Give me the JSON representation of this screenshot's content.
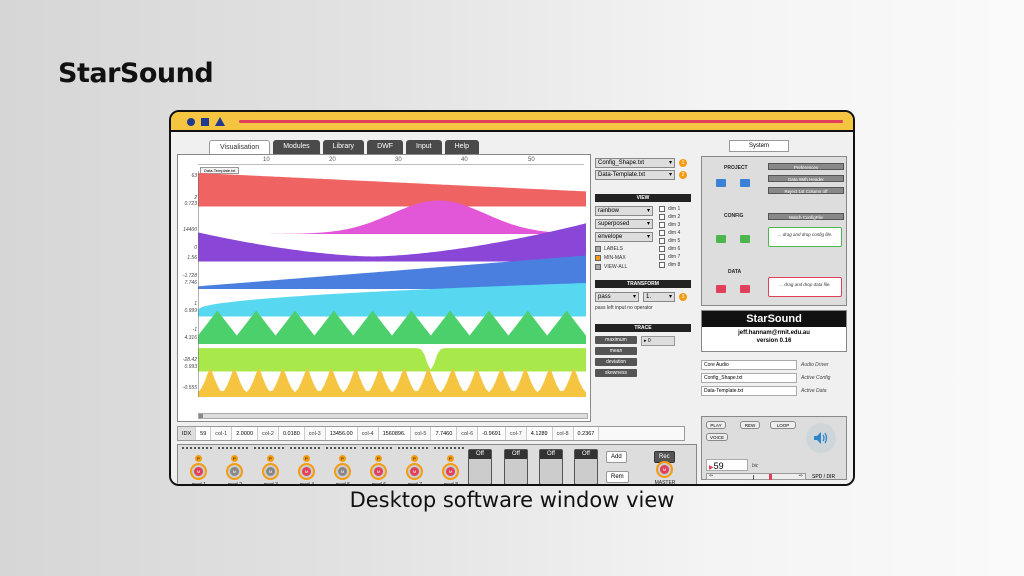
{
  "brand": "StarSound",
  "caption": "Desktop software window view",
  "tabs": [
    "Visualisation",
    "Modules",
    "Library",
    "DWF",
    "Input",
    "Help"
  ],
  "ruler": [
    "10",
    "20",
    "30",
    "40",
    "50"
  ],
  "label_chip": "Data-Template.txt",
  "ylabels": [
    "63",
    "2",
    "0.723",
    "14400",
    "0",
    "1.56",
    "-1.728",
    "7.746",
    "1",
    "0.999",
    "-1",
    "4.316",
    "-28.42",
    "0.993",
    "-0.555"
  ],
  "idx": {
    "cells": [
      "IDX",
      "59",
      "col-1",
      "2.0000",
      "col-2",
      "0.0180",
      "col-3",
      "13456.00",
      "col-4",
      "1560896.",
      "col-5",
      "7.7460",
      "col-6",
      "-0.9691",
      "col-7",
      "4.1289",
      "col-8",
      "0.2367"
    ]
  },
  "mods": [
    "mod-1",
    "mod-2",
    "mod-3",
    "mod-4",
    "mod-5",
    "mod-6",
    "mod-7",
    "mod-8"
  ],
  "mixer": {
    "off": "Off",
    "p": "P",
    "m": "M",
    "add": "Add",
    "rem": "Rem",
    "rec": "Rec",
    "master": "MASTER"
  },
  "controls": {
    "config_file": "Config_Shape.txt",
    "data_file": "Data-Template.txt",
    "badge1": "1",
    "badge2": "2",
    "badge3": "3",
    "view_header": "VIEW",
    "color_mode": "rainbow",
    "layout_mode": "superposed",
    "shape_mode": "envelope",
    "checks": [
      "LABELS",
      "MIN-MAX",
      "VIEW-ALL"
    ],
    "dims": [
      "dim 1",
      "dim 2",
      "dim 3",
      "dim 4",
      "dim 5",
      "dim 6",
      "dim 7",
      "dim 8"
    ],
    "transform_header": "TRANSFORM",
    "transform_mode": "pass",
    "transform_value": "1.",
    "transform_note": "pass left input no operator",
    "trace_header": "TRACE",
    "trace_buttons": [
      "maximum",
      "mean",
      "deviation",
      "skewness"
    ],
    "trace_value": "0"
  },
  "system": {
    "tab": "System",
    "project": "PROJECT",
    "preferences": "Preferences",
    "data_with_header": "Data With Header",
    "reject_col": "Reject 1st Column off",
    "config": "CONFIG",
    "watch_config": "Watch ConfigFile",
    "config_drop": "... drag and drop config file.",
    "data": "DATA",
    "data_drop": "... drag and drop data file.",
    "app_name": "StarSound",
    "email": "jeff.hannam@rmit.edu.au",
    "version": "version 0.16",
    "audio_driver_val": "Core Audio",
    "audio_driver_key": "Audio Driver",
    "active_config_val": "Config_Shape.txt",
    "active_config_key": "Active Config",
    "active_data_val": "Data-Template.txt",
    "active_data_key": "Active Data",
    "play": "PLAY",
    "rew": "REW",
    "loop": "LOOP",
    "voice": "VOICE",
    "bpm": "59",
    "bpm_unit": "bic",
    "spd": "SPD / DIR"
  },
  "chart_data": {
    "type": "area",
    "series": [
      {
        "color": "#f06363",
        "shape": "ramp-down"
      },
      {
        "color": "#e257d8",
        "shape": "bell"
      },
      {
        "color": "#8a46d6",
        "shape": "valley"
      },
      {
        "color": "#4a7fe0",
        "shape": "ramp-up"
      },
      {
        "color": "#58d8f0",
        "shape": "log-rise"
      },
      {
        "color": "#4cd06c",
        "shape": "triangles"
      },
      {
        "color": "#a8e84a",
        "shape": "flat-dip"
      },
      {
        "color": "#f5c542",
        "shape": "spiky"
      }
    ]
  }
}
